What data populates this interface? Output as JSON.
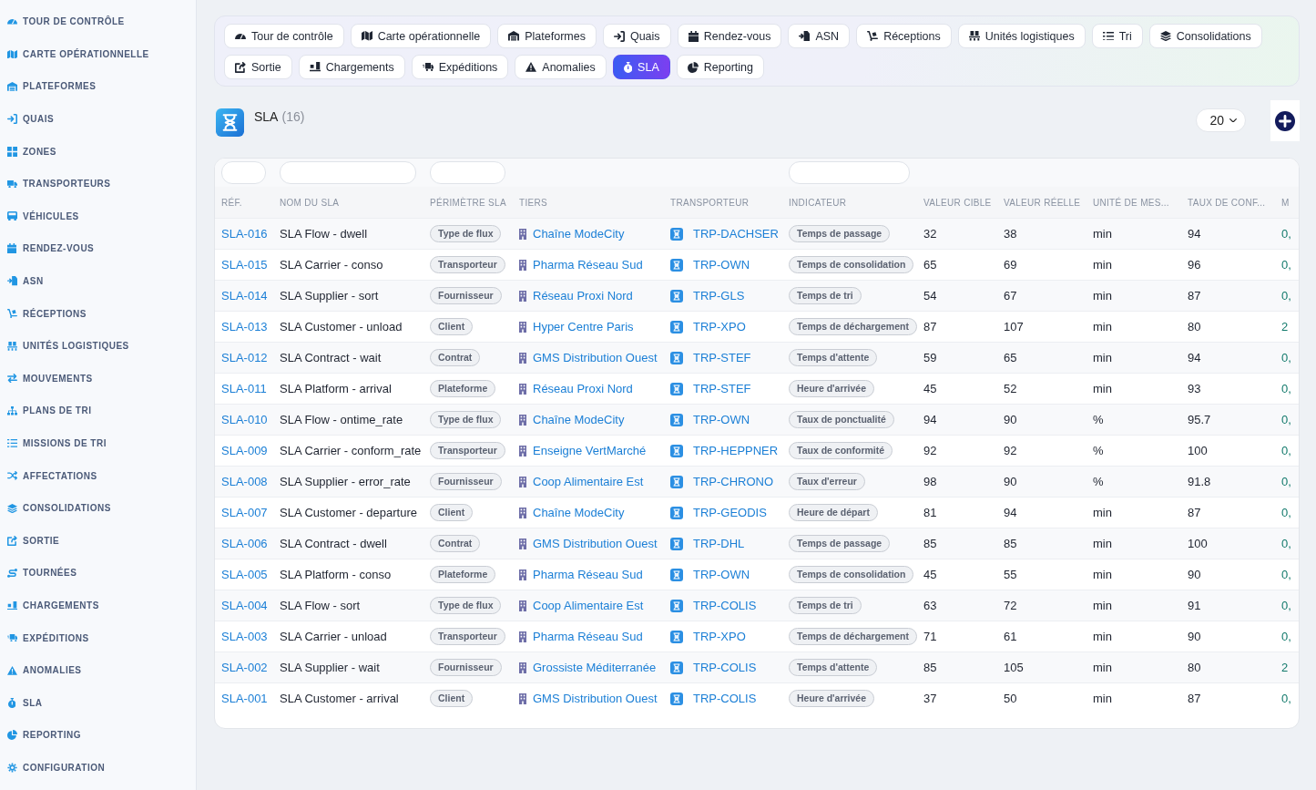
{
  "sidebar": {
    "items": [
      "TOUR DE CONTRÔLE",
      "CARTE OPÉRATIONNELLE",
      "PLATEFORMES",
      "QUAIS",
      "ZONES",
      "TRANSPORTEURS",
      "VÉHICULES",
      "RENDEZ-VOUS",
      "ASN",
      "RÉCEPTIONS",
      "UNITÉS LOGISTIQUES",
      "MOUVEMENTS",
      "PLANS DE TRI",
      "MISSIONS DE TRI",
      "AFFECTATIONS",
      "CONSOLIDATIONS",
      "SORTIE",
      "TOURNÉES",
      "CHARGEMENTS",
      "EXPÉDITIONS",
      "ANOMALIES",
      "SLA",
      "REPORTING",
      "CONFIGURATION"
    ]
  },
  "tabs": [
    {
      "label": "Tour de contrôle",
      "selected": false
    },
    {
      "label": "Carte opérationnelle",
      "selected": false
    },
    {
      "label": "Plateformes",
      "selected": false
    },
    {
      "label": "Quais",
      "selected": false
    },
    {
      "label": "Rendez-vous",
      "selected": false
    },
    {
      "label": "ASN",
      "selected": false
    },
    {
      "label": "Réceptions",
      "selected": false
    },
    {
      "label": "Unités logistiques",
      "selected": false
    },
    {
      "label": "Tri",
      "selected": false
    },
    {
      "label": "Consolidations",
      "selected": false
    },
    {
      "label": "Sortie",
      "selected": false
    },
    {
      "label": "Chargements",
      "selected": false
    },
    {
      "label": "Expéditions",
      "selected": false
    },
    {
      "label": "Anomalies",
      "selected": false
    },
    {
      "label": "SLA",
      "selected": true
    },
    {
      "label": "Reporting",
      "selected": false
    }
  ],
  "page_header": {
    "title": "SLA",
    "count": "(16)",
    "page_size": "20"
  },
  "table": {
    "columns": [
      {
        "label": "RÉF.",
        "filter": true
      },
      {
        "label": "NOM DU SLA",
        "filter": true
      },
      {
        "label": "PÉRIMÈTRE SLA",
        "filter": true
      },
      {
        "label": "TIERS",
        "filter": false
      },
      {
        "label": "TRANSPORTEUR",
        "filter": false
      },
      {
        "label": "INDICATEUR",
        "filter": true
      },
      {
        "label": "VALEUR CIBLE",
        "filter": false
      },
      {
        "label": "VALEUR RÉELLE",
        "filter": false
      },
      {
        "label": "UNITÉ DE MES...",
        "filter": false
      },
      {
        "label": "TAUX DE CONF...",
        "filter": false
      },
      {
        "label": "M",
        "filter": false
      }
    ],
    "rows": [
      {
        "ref": "SLA-016",
        "name": "SLA Flow - dwell",
        "perimeter": "Type de flux",
        "tiers": "Chaîne ModeCity",
        "carrier": "TRP-DACHSER",
        "indicator": "Temps de passage",
        "target": "32",
        "actual": "38",
        "unit": "min",
        "compliance": "94",
        "column_11": "0,"
      },
      {
        "ref": "SLA-015",
        "name": "SLA Carrier - conso",
        "perimeter": "Transporteur",
        "tiers": "Pharma Réseau Sud",
        "carrier": "TRP-OWN",
        "indicator": "Temps de consolidation",
        "target": "65",
        "actual": "69",
        "unit": "min",
        "compliance": "96",
        "column_11": "0,"
      },
      {
        "ref": "SLA-014",
        "name": "SLA Supplier - sort",
        "perimeter": "Fournisseur",
        "tiers": "Réseau Proxi Nord",
        "carrier": "TRP-GLS",
        "indicator": "Temps de tri",
        "target": "54",
        "actual": "67",
        "unit": "min",
        "compliance": "87",
        "column_11": "0,"
      },
      {
        "ref": "SLA-013",
        "name": "SLA Customer - unload",
        "perimeter": "Client",
        "tiers": "Hyper Centre Paris",
        "carrier": "TRP-XPO",
        "indicator": "Temps de déchargement",
        "target": "87",
        "actual": "107",
        "unit": "min",
        "compliance": "80",
        "column_11": "2"
      },
      {
        "ref": "SLA-012",
        "name": "SLA Contract - wait",
        "perimeter": "Contrat",
        "tiers": "GMS Distribution Ouest",
        "carrier": "TRP-STEF",
        "indicator": "Temps d'attente",
        "target": "59",
        "actual": "65",
        "unit": "min",
        "compliance": "94",
        "column_11": "0,"
      },
      {
        "ref": "SLA-011",
        "name": "SLA Platform - arrival",
        "perimeter": "Plateforme",
        "tiers": "Réseau Proxi Nord",
        "carrier": "TRP-STEF",
        "indicator": "Heure d'arrivée",
        "target": "45",
        "actual": "52",
        "unit": "min",
        "compliance": "93",
        "column_11": "0,"
      },
      {
        "ref": "SLA-010",
        "name": "SLA Flow - ontime_rate",
        "perimeter": "Type de flux",
        "tiers": "Chaîne ModeCity",
        "carrier": "TRP-OWN",
        "indicator": "Taux de ponctualité",
        "target": "94",
        "actual": "90",
        "unit": "%",
        "compliance": "95.7",
        "column_11": "0,"
      },
      {
        "ref": "SLA-009",
        "name": "SLA Carrier - conform_rate",
        "perimeter": "Transporteur",
        "tiers": "Enseigne VertMarché",
        "carrier": "TRP-HEPPNER",
        "indicator": "Taux de conformité",
        "target": "92",
        "actual": "92",
        "unit": "%",
        "compliance": "100",
        "column_11": "0,"
      },
      {
        "ref": "SLA-008",
        "name": "SLA Supplier - error_rate",
        "perimeter": "Fournisseur",
        "tiers": "Coop Alimentaire Est",
        "carrier": "TRP-CHRONO",
        "indicator": "Taux d'erreur",
        "target": "98",
        "actual": "90",
        "unit": "%",
        "compliance": "91.8",
        "column_11": "0,"
      },
      {
        "ref": "SLA-007",
        "name": "SLA Customer - departure",
        "perimeter": "Client",
        "tiers": "Chaîne ModeCity",
        "carrier": "TRP-GEODIS",
        "indicator": "Heure de départ",
        "target": "81",
        "actual": "94",
        "unit": "min",
        "compliance": "87",
        "column_11": "0,"
      },
      {
        "ref": "SLA-006",
        "name": "SLA Contract - dwell",
        "perimeter": "Contrat",
        "tiers": "GMS Distribution Ouest",
        "carrier": "TRP-DHL",
        "indicator": "Temps de passage",
        "target": "85",
        "actual": "85",
        "unit": "min",
        "compliance": "100",
        "column_11": "0,"
      },
      {
        "ref": "SLA-005",
        "name": "SLA Platform - conso",
        "perimeter": "Plateforme",
        "tiers": "Pharma Réseau Sud",
        "carrier": "TRP-OWN",
        "indicator": "Temps de consolidation",
        "target": "45",
        "actual": "55",
        "unit": "min",
        "compliance": "90",
        "column_11": "0,"
      },
      {
        "ref": "SLA-004",
        "name": "SLA Flow - sort",
        "perimeter": "Type de flux",
        "tiers": "Coop Alimentaire Est",
        "carrier": "TRP-COLIS",
        "indicator": "Temps de tri",
        "target": "63",
        "actual": "72",
        "unit": "min",
        "compliance": "91",
        "column_11": "0,"
      },
      {
        "ref": "SLA-003",
        "name": "SLA Carrier - unload",
        "perimeter": "Transporteur",
        "tiers": "Pharma Réseau Sud",
        "carrier": "TRP-XPO",
        "indicator": "Temps de déchargement",
        "target": "71",
        "actual": "61",
        "unit": "min",
        "compliance": "90",
        "column_11": "0,"
      },
      {
        "ref": "SLA-002",
        "name": "SLA Supplier - wait",
        "perimeter": "Fournisseur",
        "tiers": "Grossiste Méditerranée",
        "carrier": "TRP-COLIS",
        "indicator": "Temps d'attente",
        "target": "85",
        "actual": "105",
        "unit": "min",
        "compliance": "80",
        "column_11": "2"
      },
      {
        "ref": "SLA-001",
        "name": "SLA Customer - arrival",
        "perimeter": "Client",
        "tiers": "GMS Distribution Ouest",
        "carrier": "TRP-COLIS",
        "indicator": "Heure d'arrivée",
        "target": "37",
        "actual": "50",
        "unit": "min",
        "compliance": "87",
        "column_11": "0,"
      }
    ]
  }
}
